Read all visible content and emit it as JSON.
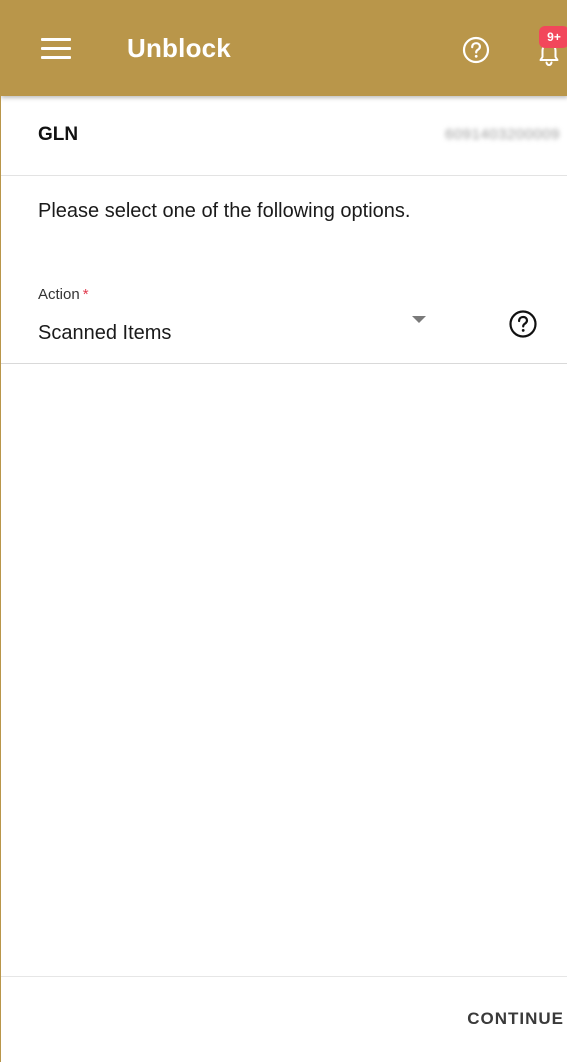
{
  "header": {
    "title": "Unblock",
    "menu_icon": "menu-icon",
    "help_icon": "help-circle-icon",
    "bell_icon": "bell-icon",
    "notification_badge": "9+",
    "background_color": "#b9964a",
    "badge_color": "#f2475b"
  },
  "gln": {
    "label": "GLN",
    "value": "6091403200009"
  },
  "instruction": "Please select one of the following options.",
  "action_field": {
    "label": "Action",
    "required_marker": "*",
    "selected_value": "Scanned Items",
    "arrow_icon": "dropdown-arrow-icon",
    "help_icon": "help-circle-icon"
  },
  "footer": {
    "continue_label": "CONTINUE"
  }
}
